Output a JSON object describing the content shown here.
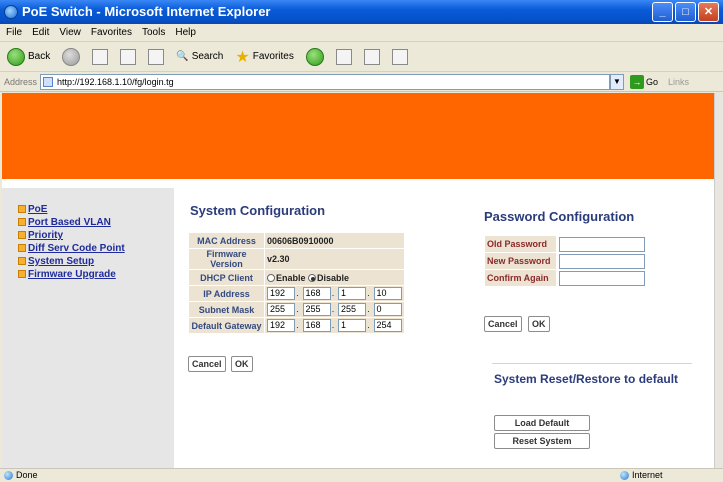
{
  "window": {
    "title": "PoE Switch - Microsoft Internet Explorer",
    "min": "_",
    "max": "□",
    "close": "✕"
  },
  "menu": [
    "File",
    "Edit",
    "View",
    "Favorites",
    "Tools",
    "Help"
  ],
  "toolbar": {
    "back": "Back",
    "search": "Search",
    "favorites": "Favorites"
  },
  "address": {
    "label": "Address",
    "url": "http://192.168.1.10/fg/login.tg",
    "go": "Go",
    "links": "Links"
  },
  "sidebar": {
    "items": [
      {
        "label": "PoE"
      },
      {
        "label": "Port Based VLAN"
      },
      {
        "label": "Priority"
      },
      {
        "label": "Diff Serv Code Point"
      },
      {
        "label": "System Setup"
      },
      {
        "label": "Firmware Upgrade"
      }
    ]
  },
  "system": {
    "title": "System Configuration",
    "mac_label": "MAC Address",
    "mac_value": "00606B0910000",
    "fw_label": "Firmware Version",
    "fw_value": "v2.30",
    "dhcp_label": "DHCP Client",
    "enable_label": "Enable",
    "disable_label": "Disable",
    "dhcp_selected": "Disable",
    "ip_label": "IP Address",
    "ip": [
      "192",
      "168",
      "1",
      "10"
    ],
    "mask_label": "Subnet Mask",
    "mask": [
      "255",
      "255",
      "255",
      "0"
    ],
    "gw_label": "Default Gateway",
    "gw": [
      "192",
      "168",
      "1",
      "254"
    ],
    "cancel": "Cancel",
    "ok": "OK"
  },
  "password": {
    "title": "Password Configuration",
    "old_label": "Old Password",
    "new_label": "New Password",
    "confirm_label": "Confirm Again",
    "cancel": "Cancel",
    "ok": "OK"
  },
  "reset": {
    "title": "System Reset/Restore to default",
    "load_default": "Load Default",
    "reset_system": "Reset System"
  },
  "status": {
    "left": "Done",
    "right": "Internet"
  },
  "colors": {
    "banner": "#ff6600",
    "sidebar": "#e6e6e6",
    "table_bg": "#ece3d3",
    "heading": "#2b3c7a"
  }
}
